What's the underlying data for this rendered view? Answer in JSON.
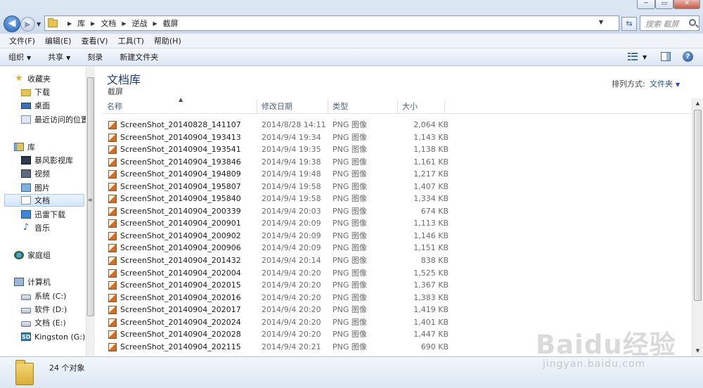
{
  "window": {
    "minimize": "─",
    "maximize": "▭",
    "close": "✕"
  },
  "address": {
    "crumbs": [
      "库",
      "文档",
      "逆战",
      "截屏"
    ],
    "search_placeholder": "搜索 截屏"
  },
  "menu": [
    "文件(F)",
    "编辑(E)",
    "查看(V)",
    "工具(T)",
    "帮助(H)"
  ],
  "commands": {
    "organize": "组织",
    "share": "共享",
    "burn": "刻录",
    "new_folder": "新建文件夹"
  },
  "nav": {
    "favorites": {
      "label": "收藏夹",
      "icon": "star-icon"
    },
    "downloads": {
      "label": "下载",
      "icon": "folder-icon"
    },
    "desktop": {
      "label": "桌面",
      "icon": "desktop-icon"
    },
    "recent": {
      "label": "最近访问的位置",
      "icon": "recent-places-icon"
    },
    "libraries": {
      "label": "库",
      "icon": "library-icon"
    },
    "baofeng": {
      "label": "暴风影视库",
      "icon": "movie-library-icon"
    },
    "videos": {
      "label": "视频",
      "icon": "video-icon"
    },
    "pictures": {
      "label": "图片",
      "icon": "pictures-icon"
    },
    "documents": {
      "label": "文档",
      "icon": "documents-icon"
    },
    "thunder": {
      "label": "迅雷下载",
      "icon": "thunder-icon"
    },
    "music": {
      "label": "音乐",
      "icon": "music-icon"
    },
    "homegroup": {
      "label": "家庭组",
      "icon": "homegroup-icon"
    },
    "computer": {
      "label": "计算机",
      "icon": "computer-icon"
    },
    "drive_c": {
      "label": "系统 (C:)",
      "icon": "drive-icon"
    },
    "drive_d": {
      "label": "软件 (D:)",
      "icon": "drive-icon"
    },
    "drive_e": {
      "label": "文档 (E:)",
      "icon": "drive-icon"
    },
    "drive_g": {
      "label": "Kingston (G:)",
      "icon": "sd-card-icon"
    },
    "grip": "≡"
  },
  "library": {
    "title": "文档库",
    "subtitle": "截屏",
    "arrange_label": "排列方式:",
    "arrange_value": "文件夹"
  },
  "columns": {
    "name": "名称",
    "date": "修改日期",
    "type": "类型",
    "size": "大小"
  },
  "files": [
    {
      "name": "ScreenShot_20140828_141107",
      "date": "2014/8/28 14:11",
      "type": "PNG 图像",
      "size": "2,064 KB"
    },
    {
      "name": "ScreenShot_20140904_193413",
      "date": "2014/9/4 19:34",
      "type": "PNG 图像",
      "size": "1,143 KB"
    },
    {
      "name": "ScreenShot_20140904_193541",
      "date": "2014/9/4 19:35",
      "type": "PNG 图像",
      "size": "1,138 KB"
    },
    {
      "name": "ScreenShot_20140904_193846",
      "date": "2014/9/4 19:38",
      "type": "PNG 图像",
      "size": "1,161 KB"
    },
    {
      "name": "ScreenShot_20140904_194809",
      "date": "2014/9/4 19:48",
      "type": "PNG 图像",
      "size": "1,217 KB"
    },
    {
      "name": "ScreenShot_20140904_195807",
      "date": "2014/9/4 19:58",
      "type": "PNG 图像",
      "size": "1,407 KB"
    },
    {
      "name": "ScreenShot_20140904_195840",
      "date": "2014/9/4 19:58",
      "type": "PNG 图像",
      "size": "1,334 KB"
    },
    {
      "name": "ScreenShot_20140904_200339",
      "date": "2014/9/4 20:03",
      "type": "PNG 图像",
      "size": "674 KB"
    },
    {
      "name": "ScreenShot_20140904_200901",
      "date": "2014/9/4 20:09",
      "type": "PNG 图像",
      "size": "1,113 KB"
    },
    {
      "name": "ScreenShot_20140904_200902",
      "date": "2014/9/4 20:09",
      "type": "PNG 图像",
      "size": "1,146 KB"
    },
    {
      "name": "ScreenShot_20140904_200906",
      "date": "2014/9/4 20:09",
      "type": "PNG 图像",
      "size": "1,151 KB"
    },
    {
      "name": "ScreenShot_20140904_201432",
      "date": "2014/9/4 20:14",
      "type": "PNG 图像",
      "size": "838 KB"
    },
    {
      "name": "ScreenShot_20140904_202004",
      "date": "2014/9/4 20:20",
      "type": "PNG 图像",
      "size": "1,525 KB"
    },
    {
      "name": "ScreenShot_20140904_202015",
      "date": "2014/9/4 20:20",
      "type": "PNG 图像",
      "size": "1,367 KB"
    },
    {
      "name": "ScreenShot_20140904_202016",
      "date": "2014/9/4 20:20",
      "type": "PNG 图像",
      "size": "1,383 KB"
    },
    {
      "name": "ScreenShot_20140904_202017",
      "date": "2014/9/4 20:20",
      "type": "PNG 图像",
      "size": "1,419 KB"
    },
    {
      "name": "ScreenShot_20140904_202024",
      "date": "2014/9/4 20:20",
      "type": "PNG 图像",
      "size": "1,401 KB"
    },
    {
      "name": "ScreenShot_20140904_202028",
      "date": "2014/9/4 20:20",
      "type": "PNG 图像",
      "size": "1,447 KB"
    },
    {
      "name": "ScreenShot_20140904_202115",
      "date": "2014/9/4 20:21",
      "type": "PNG 图像",
      "size": "690 KB"
    }
  ],
  "details": {
    "count": "24 个对象"
  },
  "watermark": {
    "brand": "Baidu经验",
    "url": "jingyan.baidu.com"
  }
}
